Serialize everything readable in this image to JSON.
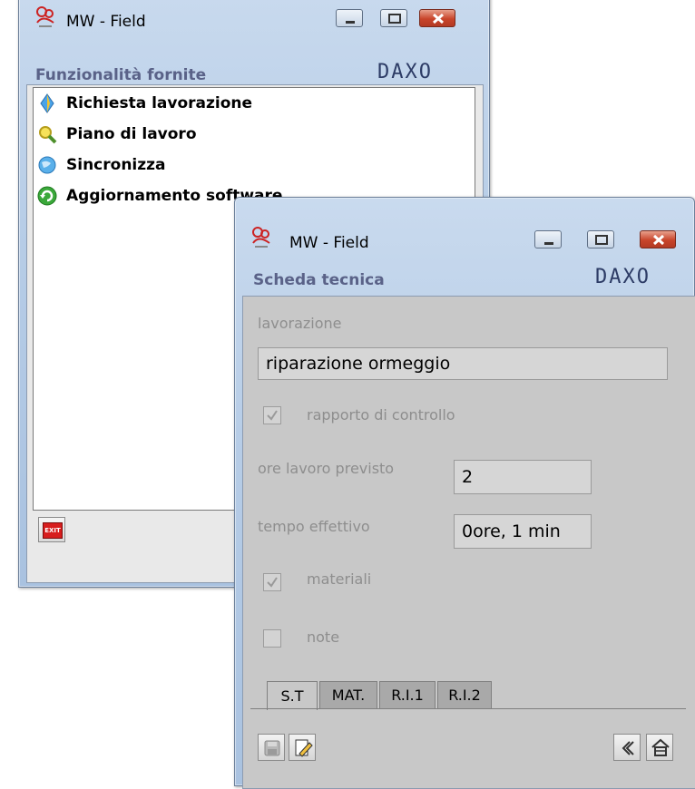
{
  "window1": {
    "title": "MW - Field",
    "header": "Funzionalità fornite",
    "brand": "DAXO",
    "items": [
      {
        "label": "Richiesta lavorazione",
        "icon": "diamond-icon"
      },
      {
        "label": "Piano di lavoro",
        "icon": "magnifier-icon"
      },
      {
        "label": "Sincronizza",
        "icon": "globe-icon"
      },
      {
        "label": "Aggiornamento software",
        "icon": "update-icon"
      }
    ],
    "exit_label": "EXIT"
  },
  "window2": {
    "title": "MW - Field",
    "header": "Scheda tecnica",
    "brand": "DAXO",
    "lavorazione_label": "lavorazione",
    "lavorazione_value": "riparazione ormeggio",
    "rapporto_label": "rapporto di controllo",
    "rapporto_checked": true,
    "ore_label": "ore lavoro previsto",
    "ore_value": "2",
    "tempo_label": "tempo effettivo",
    "tempo_value": "0ore, 1 min",
    "materiali_label": "materiali",
    "materiali_checked": true,
    "note_label": "note",
    "note_checked": false,
    "tabs": [
      "S.T",
      "MAT.",
      "R.I.1",
      "R.I.2"
    ],
    "active_tab": "S.T"
  },
  "colors": {
    "header_text": "#5a6288",
    "brand": "#2d3c66",
    "disabled_text": "#8e8e8e",
    "close_red": "#c8442a"
  }
}
